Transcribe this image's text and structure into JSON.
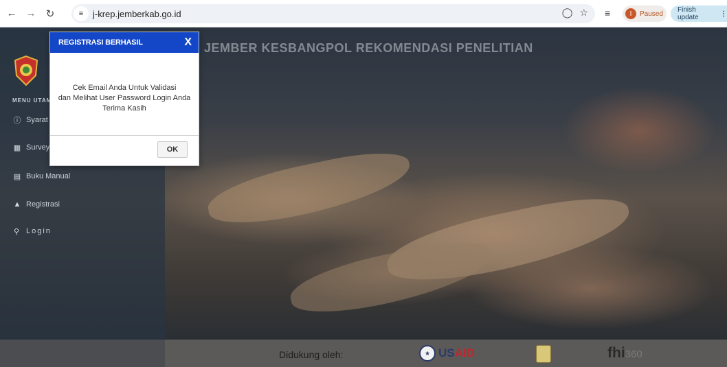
{
  "browser": {
    "url": "j-krep.jemberkab.go.id",
    "profile_status": "Paused",
    "profile_initial": "I",
    "update_button": "Finish update"
  },
  "header": {
    "title": "JEMBER KESBANGPOL REKOMENDASI PENELITIAN"
  },
  "sidebar": {
    "menu_title": "MENU UTAMA",
    "items": [
      {
        "label": "Syarat",
        "icon": "info-icon"
      },
      {
        "label": "Survey",
        "icon": "keyboard-icon"
      },
      {
        "label": "Buku Manual",
        "icon": "book-icon"
      },
      {
        "label": "Registrasi",
        "icon": "user-icon"
      },
      {
        "label": "Login",
        "icon": "key-icon"
      }
    ]
  },
  "modal": {
    "title": "REGISTRASI BERHASIL",
    "close_label": "X",
    "line1": "Cek Email Anda Untuk Validasi",
    "line2": "dan Melihat User Password Login Anda",
    "line3": "Terima Kasih",
    "ok_label": "OK"
  },
  "footer": {
    "supported_by": "Didukung oleh:",
    "usaid_prefix": "US",
    "usaid_suffix": "AID",
    "fhi_text": "fhi",
    "fhi_number": "360"
  },
  "colors": {
    "modal_header": "#1447c8",
    "sidebar": "#283442",
    "footer": "#5c5a58"
  }
}
